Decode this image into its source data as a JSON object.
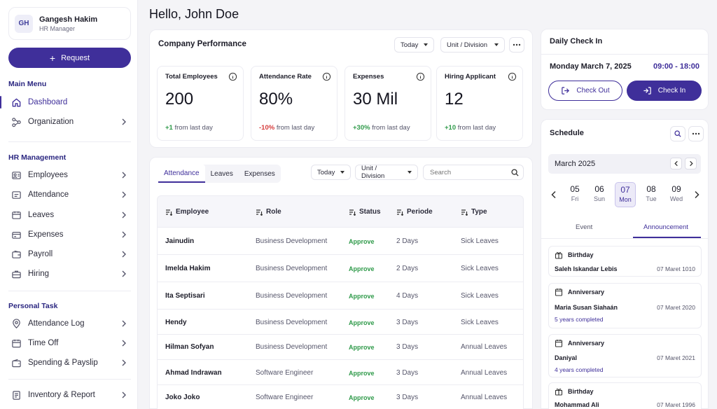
{
  "sidebar": {
    "profile": {
      "initials": "GH",
      "name": "Gangesh Hakim",
      "role": "HR Manager"
    },
    "request_label": "Request",
    "sections": {
      "main_menu": "Main Menu",
      "hr_management": "HR Management",
      "personal_task": "Personal Task"
    },
    "main_items": [
      {
        "label": "Dashboard",
        "icon": "home-icon",
        "active": true
      },
      {
        "label": "Organization",
        "icon": "organization-icon"
      }
    ],
    "hr_items": [
      {
        "label": "Employees",
        "icon": "employees-icon"
      },
      {
        "label": "Attendance",
        "icon": "attendance-icon"
      },
      {
        "label": "Leaves",
        "icon": "leaves-icon"
      },
      {
        "label": "Expenses",
        "icon": "expenses-icon"
      },
      {
        "label": "Payroll",
        "icon": "payroll-icon"
      },
      {
        "label": "Hiring",
        "icon": "hiring-icon"
      }
    ],
    "personal_items": [
      {
        "label": "Attendance Log",
        "icon": "location-icon"
      },
      {
        "label": "Time Off",
        "icon": "calendar-icon"
      },
      {
        "label": "Spending & Payslip",
        "icon": "wallet-icon"
      }
    ],
    "bottom_items": [
      {
        "label": "Inventory & Report",
        "icon": "report-icon"
      }
    ]
  },
  "greeting": "Hello, John Doe",
  "performance": {
    "title": "Company Performance",
    "period": "Today",
    "unit": "Unit / Division",
    "stats": [
      {
        "label": "Total Employees",
        "value": "200",
        "change": "+1",
        "change_type": "positive",
        "suffix": "from last day"
      },
      {
        "label": "Attendance Rate",
        "value": "80%",
        "change": "-10%",
        "change_type": "negative",
        "suffix": "from last day"
      },
      {
        "label": "Expenses",
        "value": "30 Mil",
        "change": "+30%",
        "change_type": "positive",
        "suffix": "from last day"
      },
      {
        "label": "Hiring Applicant",
        "value": "12",
        "change": "+10",
        "change_type": "positive",
        "suffix": "from last day"
      }
    ]
  },
  "table": {
    "tabs": [
      "Attendance",
      "Leaves",
      "Expenses"
    ],
    "active_tab": 0,
    "period": "Today",
    "unit": "Unit / Division",
    "search_placeholder": "Search",
    "columns": [
      "Employee",
      "Role",
      "Status",
      "Periode",
      "Type"
    ],
    "rows": [
      {
        "employee": "Jainudin",
        "role": "Business Development",
        "status": "Approve",
        "periode": "2 Days",
        "type": "Sick Leaves"
      },
      {
        "employee": "Imelda Hakim",
        "role": "Business Development",
        "status": "Approve",
        "periode": "2 Days",
        "type": "Sick Leaves"
      },
      {
        "employee": "Ita Septisari",
        "role": "Business Development",
        "status": "Approve",
        "periode": "4 Days",
        "type": "Sick Leaves"
      },
      {
        "employee": "Hendy",
        "role": "Business Development",
        "status": "Approve",
        "periode": "3 Days",
        "type": "Sick Leaves"
      },
      {
        "employee": "Hilman Sofyan",
        "role": "Business Development",
        "status": "Approve",
        "periode": "3 Days",
        "type": "Annual Leaves"
      },
      {
        "employee": "Ahmad Indrawan",
        "role": "Software Engineer",
        "status": "Approve",
        "periode": "3 Days",
        "type": "Annual Leaves"
      },
      {
        "employee": "Joko Joko",
        "role": "Software Engineer",
        "status": "Approve",
        "periode": "3 Days",
        "type": "Annual Leaves"
      }
    ]
  },
  "checkin": {
    "title": "Daily Check In",
    "date": "Monday March 7, 2025",
    "time": "09:00 - 18:00",
    "check_out_label": "Check Out",
    "check_in_label": "Check In"
  },
  "schedule": {
    "title": "Schedule",
    "month": "March 2025",
    "days": [
      {
        "num": "05",
        "wd": "Fri"
      },
      {
        "num": "06",
        "wd": "Sun"
      },
      {
        "num": "07",
        "wd": "Mon",
        "selected": true
      },
      {
        "num": "08",
        "wd": "Tue"
      },
      {
        "num": "09",
        "wd": "Wed"
      }
    ],
    "tabs": [
      "Event",
      "Announcement"
    ],
    "active_tab": 1,
    "announcements": [
      {
        "type": "Birthday",
        "name": "Saleh Iskandar Lebis",
        "date": "07 Maret 1010",
        "note": ""
      },
      {
        "type": "Anniversary",
        "name": "Maria Susan Siahaán",
        "date": "07 Maret 2020",
        "note": "5 years completed"
      },
      {
        "type": "Anniversary",
        "name": "Daniyal",
        "date": "07 Maret 2021",
        "note": "4 years completed"
      },
      {
        "type": "Birthday",
        "name": "Mohammad Ali",
        "date": "07 Maret 1996",
        "note": ""
      }
    ]
  },
  "colors": {
    "accent": "#3f2f9a",
    "positive": "#2f9a4a",
    "negative": "#d63c3c"
  }
}
